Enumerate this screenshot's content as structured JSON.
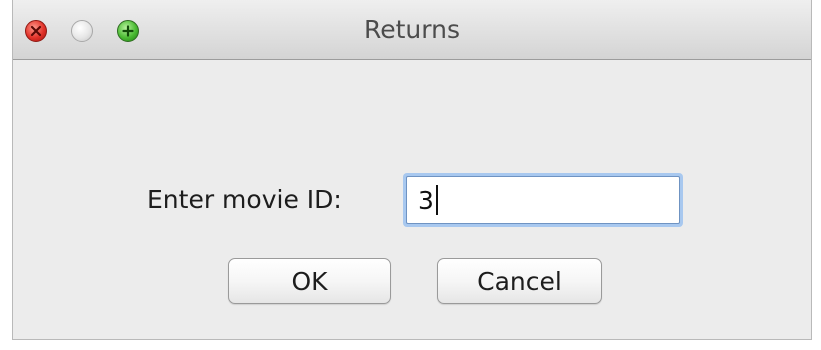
{
  "window": {
    "title": "Returns"
  },
  "titlebar": {
    "controls": [
      {
        "name": "close",
        "icon": "close-x-icon",
        "color": "#e2332a"
      },
      {
        "name": "minimize",
        "icon": "minimize-icon",
        "color": "#d9d9d9"
      },
      {
        "name": "zoom",
        "icon": "plus-icon",
        "color": "#4bbb33"
      }
    ]
  },
  "form": {
    "label": "Enter movie ID:",
    "input_value": "3"
  },
  "buttons": {
    "ok_label": "OK",
    "cancel_label": "Cancel"
  },
  "colors": {
    "focus_ring": "#a8c8ef",
    "window_bg": "#ececec"
  }
}
